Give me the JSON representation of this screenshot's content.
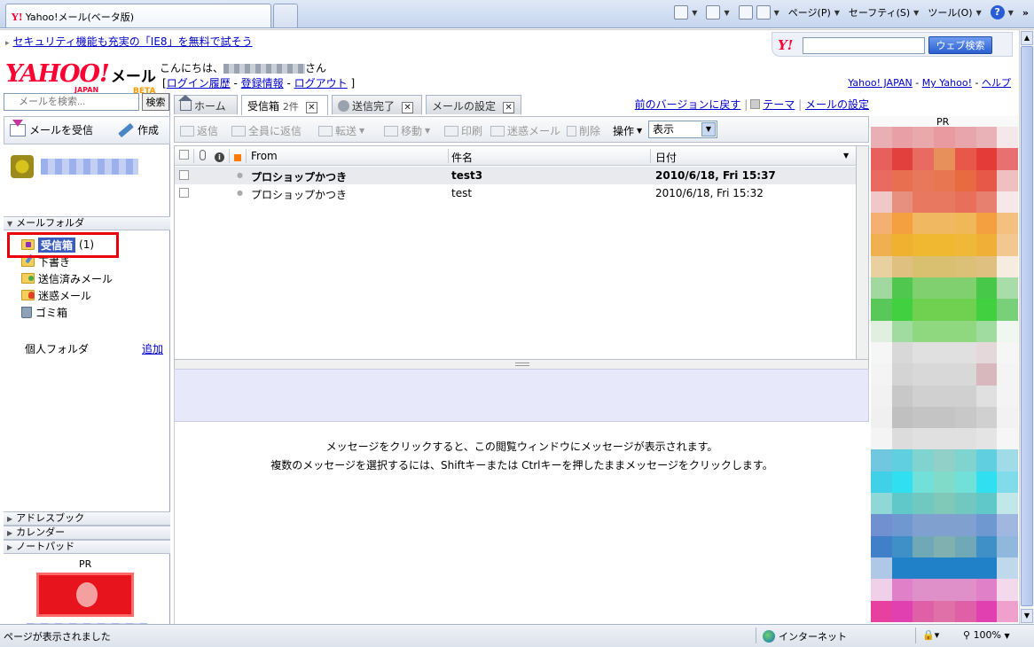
{
  "browser": {
    "tab_title": "Yahoo!メール(ベータ版)",
    "cmd": {
      "page": "ページ(P)",
      "safety": "セーフティ(S)",
      "tools": "ツール(O)",
      "help": "?"
    }
  },
  "promo": {
    "text": "セキュリティ機能も充実の「IE8」を無料で試そう"
  },
  "web_search": {
    "logo": "Y!",
    "button": "ウェブ検索",
    "value": ""
  },
  "header": {
    "logo": "YAHOO!",
    "logo_japan": "JAPAN",
    "mail_label": "メール",
    "beta": "BETA",
    "greeting_prefix": "こんにちは、",
    "greeting_suffix": "さん",
    "account_links": {
      "open": "[",
      "login_history": "ログイン履歴",
      "sep1": " - ",
      "registration": "登録情報",
      "sep2": " - ",
      "logout": "ログアウト",
      "close": " ]"
    },
    "portal_links": {
      "yahoo_japan": "Yahoo! JAPAN",
      "sep1": " - ",
      "my_yahoo": "My Yahoo!",
      "sep2": " - ",
      "help": "ヘルプ"
    }
  },
  "sidebar": {
    "search_placeholder": "メールを検索...",
    "search_button": "検索",
    "get_mail": "メールを受信",
    "compose": "作成",
    "sections": {
      "folders": "メールフォルダ",
      "address_book": "アドレスブック",
      "calendar": "カレンダー",
      "notepad": "ノートパッド"
    },
    "folders": [
      {
        "label": "受信箱",
        "count": "(1)"
      },
      {
        "label": "下書き"
      },
      {
        "label": "送信済みメール"
      },
      {
        "label": "迷惑メール"
      },
      {
        "label": "ゴミ箱"
      }
    ],
    "personal_folder": "個人フォルダ",
    "add": "追加",
    "pr": "PR"
  },
  "tabs": [
    {
      "label": "ホーム"
    },
    {
      "label": "受信箱",
      "count": "2件"
    },
    {
      "label": "送信完了"
    },
    {
      "label": "メールの設定"
    }
  ],
  "top_right_links": {
    "prev_version": "前のバージョンに戻す",
    "theme": "テーマ",
    "settings": "メールの設定"
  },
  "toolbar": {
    "reply": "返信",
    "reply_all": "全員に返信",
    "forward": "転送",
    "move": "移動",
    "print": "印刷",
    "spam": "迷惑メール",
    "delete": "削除",
    "actions": "操作",
    "view_selected": "表示"
  },
  "message_list": {
    "columns": {
      "from": "From",
      "subject": "件名",
      "date": "日付"
    },
    "rows": [
      {
        "from": "プロショップかつき",
        "subject": "test3",
        "date": "2010/6/18, Fri 15:37",
        "unread": true
      },
      {
        "from": "プロショップかつき",
        "subject": "test",
        "date": "2010/6/18, Fri 15:32",
        "unread": false
      }
    ]
  },
  "preview": {
    "line1": "メッセージをクリックすると、この閲覧ウィンドウにメッセージが表示されます。",
    "line2": "複数のメッセージを選択するには、Shiftキーまたは Ctrlキーを押したままメッセージをクリックします。"
  },
  "right_ad": {
    "pr": "PR"
  },
  "statusbar": {
    "text": "ページが表示されました",
    "zone": "インターネット",
    "zoom": "100%"
  }
}
